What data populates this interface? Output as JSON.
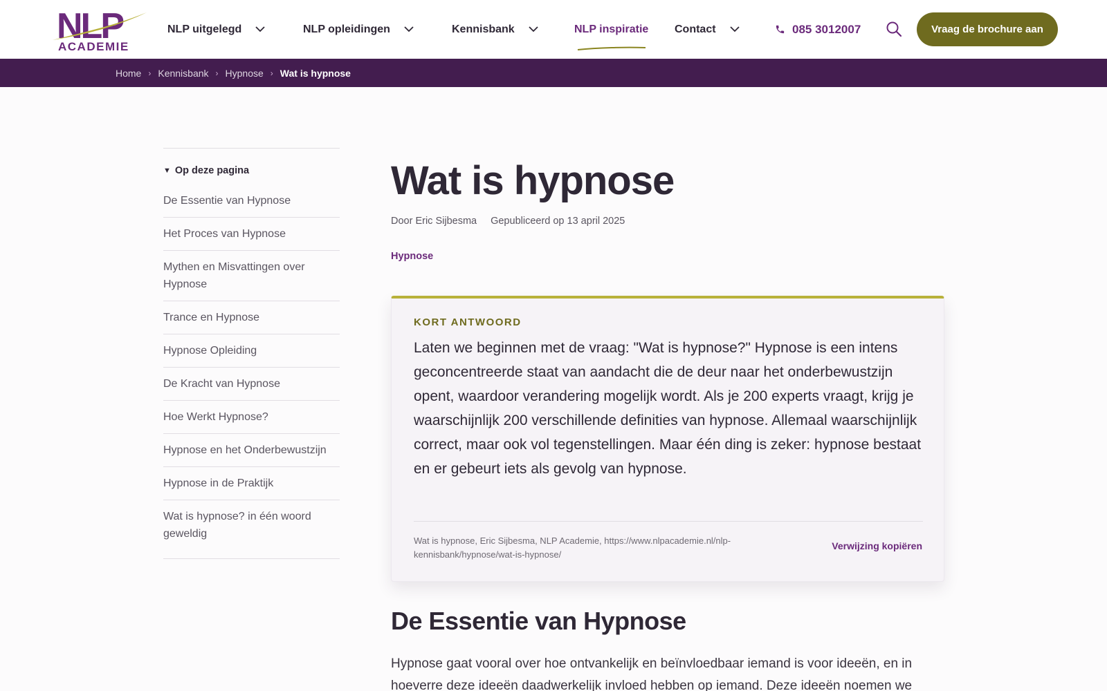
{
  "header": {
    "logo": {
      "wordmark": "NLP",
      "subtitle": "ACADEMIE"
    },
    "nav": [
      {
        "label": "NLP uitgelegd",
        "has_dropdown": true
      },
      {
        "label": "NLP opleidingen",
        "has_dropdown": true
      },
      {
        "label": "Kennisbank",
        "has_dropdown": true
      },
      {
        "label": "NLP inspiratie",
        "has_dropdown": false,
        "active": true
      },
      {
        "label": "Contact",
        "has_dropdown": true
      }
    ],
    "phone": "085 3012007",
    "cta_label": "Vraag de brochure aan"
  },
  "breadcrumb": {
    "items": [
      "Home",
      "Kennisbank",
      "Hypnose"
    ],
    "current": "Wat is hypnose"
  },
  "toc": {
    "heading": "Op deze pagina",
    "items": [
      "De Essentie van Hypnose",
      "Het Proces van Hypnose",
      "Mythen en Misvattingen over Hypnose",
      "Trance en Hypnose",
      "Hypnose Opleiding",
      "De Kracht van Hypnose",
      "Hoe Werkt Hypnose?",
      "Hypnose en het Onderbewustzijn",
      "Hypnose in de Praktijk",
      "Wat is hypnose? in één woord geweldig"
    ]
  },
  "article": {
    "title": "Wat is hypnose",
    "author": "Door Eric Sijbesma",
    "published": "Gepubliceerd op 13 april 2025",
    "tag": "Hypnose",
    "short_answer": {
      "label": "KORT ANTWOORD",
      "text": "Laten we beginnen met de vraag: \"Wat is hypnose?\" Hypnose is een intens geconcentreerde staat van aandacht die de deur naar het onderbewustzijn opent, waardoor verandering mogelijk wordt. Als je 200 experts vraagt, krijg je waarschijnlijk 200 verschillende definities van hypnose. Allemaal waarschijnlijk correct, maar ook vol tegenstellingen. Maar één ding is zeker: hypnose bestaat en er gebeurt iets als gevolg van hypnose.",
      "citation": "Wat is hypnose, Eric Sijbesma, NLP Academie, https://www.nlpacademie.nl/nlp-kennisbank/hypnose/wat-is-hypnose/",
      "copy_label": "Verwijzing kopiëren"
    },
    "section_heading": "De Essentie van Hypnose",
    "section_text": "Hypnose gaat vooral over hoe ontvankelijk en beïnvloedbaar iemand is voor ideeën, en in hoeverre deze ideeën daadwerkelijk invloed hebben op iemand. Deze ideeën noemen we"
  },
  "colors": {
    "brand_purple": "#6b2a7b",
    "breadcrumb_bg": "#431d4f",
    "olive": "#6f6b1f",
    "accent_yellow": "#b8b13a"
  }
}
